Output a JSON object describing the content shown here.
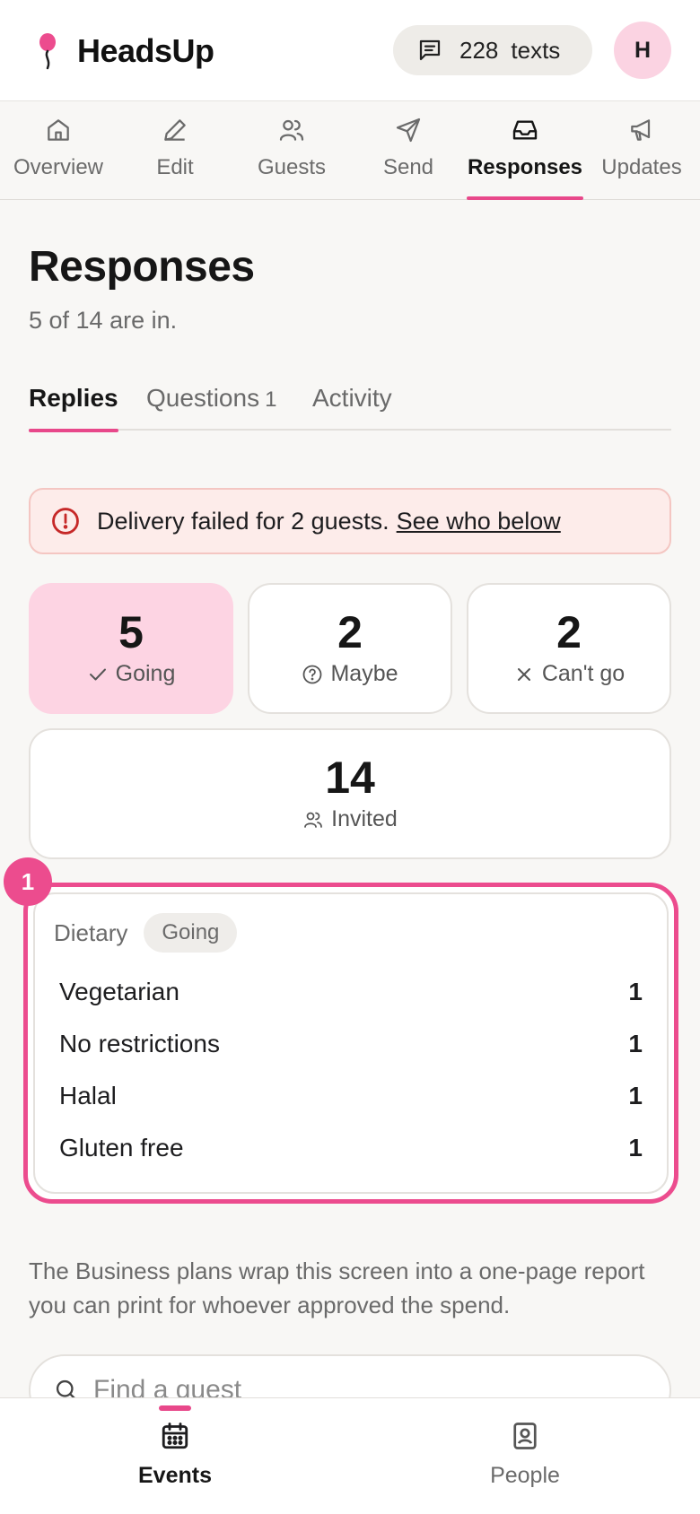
{
  "app": {
    "name": "HeadsUp"
  },
  "header": {
    "texts_count": "228",
    "texts_label": "texts",
    "avatar_initial": "H"
  },
  "nav": {
    "items": [
      {
        "label": "Overview",
        "icon": "home-icon"
      },
      {
        "label": "Edit",
        "icon": "pencil-icon"
      },
      {
        "label": "Guests",
        "icon": "users-icon"
      },
      {
        "label": "Send",
        "icon": "send-icon"
      },
      {
        "label": "Responses",
        "icon": "inbox-icon",
        "active": true
      },
      {
        "label": "Updates",
        "icon": "megaphone-icon"
      }
    ]
  },
  "page": {
    "title": "Responses",
    "subtitle": "5 of 14 are in."
  },
  "subtabs": {
    "replies": "Replies",
    "questions": "Questions",
    "questions_count": "1",
    "activity": "Activity"
  },
  "alert": {
    "text": "Delivery failed for 2 guests.",
    "link": "See who below"
  },
  "stats": {
    "going": {
      "value": "5",
      "label": "Going"
    },
    "maybe": {
      "value": "2",
      "label": "Maybe"
    },
    "cant_go": {
      "value": "2",
      "label": "Can't go"
    },
    "invited": {
      "value": "14",
      "label": "Invited"
    }
  },
  "dietary": {
    "step": "1",
    "title": "Dietary",
    "filter": "Going",
    "rows": [
      {
        "label": "Vegetarian",
        "value": "1"
      },
      {
        "label": "No restrictions",
        "value": "1"
      },
      {
        "label": "Halal",
        "value": "1"
      },
      {
        "label": "Gluten free",
        "value": "1"
      }
    ]
  },
  "promo": {
    "text": "The Business plans wrap this screen into a one-page report you can print for whoever approved the spend."
  },
  "search": {
    "placeholder": "Find a guest"
  },
  "bottom_nav": {
    "events": "Events",
    "people": "People"
  },
  "colors": {
    "accent": "#e8488a",
    "going_bg": "#fdd4e3",
    "alert_bg": "#fdecea",
    "alert_icon": "#c62828"
  }
}
